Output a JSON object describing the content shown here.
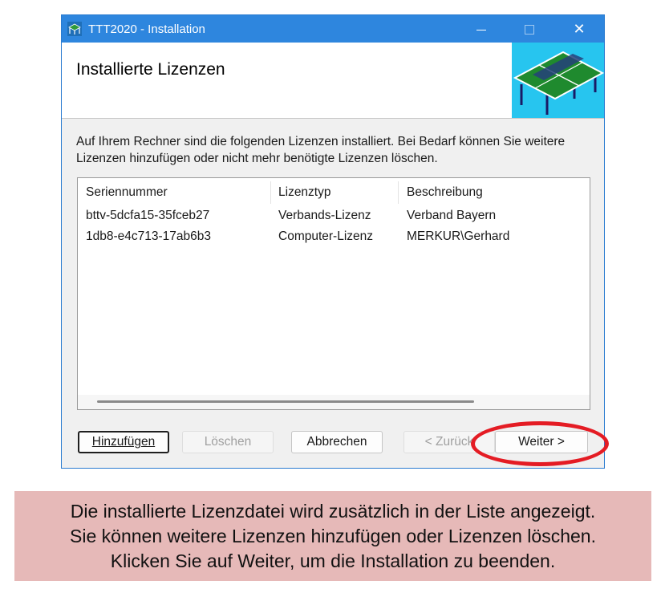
{
  "window": {
    "title": "TTT2020 - Installation",
    "accent_color": "#2e86de",
    "controls": {
      "minimize_icon": "minimize-icon",
      "maximize_icon": "maximize-icon",
      "close_icon": "close-icon",
      "close_glyph": "✕"
    }
  },
  "header": {
    "title": "Installierte Lizenzen",
    "image_icon": "ping-pong-table-icon",
    "image_background": "#27c5ef"
  },
  "description": "Auf Ihrem Rechner sind die folgenden Lizenzen installiert. Bei Bedarf können Sie weitere Lizenzen hinzufügen oder nicht mehr benötigte Lizenzen löschen.",
  "license_list": {
    "columns": [
      "Seriennummer",
      "Lizenztyp",
      "Beschreibung"
    ],
    "rows": [
      [
        "bttv-5dcfa15-35fceb27",
        "Verbands-Lizenz",
        "Verband Bayern"
      ],
      [
        "1db8-e4c713-17ab6b3",
        "Computer-Lizenz",
        "MERKUR\\Gerhard"
      ]
    ]
  },
  "buttons": {
    "add": "Hinzufügen",
    "delete": "Löschen",
    "cancel": "Abbrechen",
    "back": "< Zurück",
    "next": "Weiter >"
  },
  "annotation": {
    "highlight_color": "#e41c24",
    "caption_background": "#e6b9b8",
    "caption_lines": [
      "Die installierte Lizenzdatei wird zusätzlich in der Liste angezeigt.",
      "Sie können weitere Lizenzen hinzufügen oder Lizenzen löschen.",
      "Klicken Sie auf Weiter, um die Installation zu beenden."
    ]
  }
}
